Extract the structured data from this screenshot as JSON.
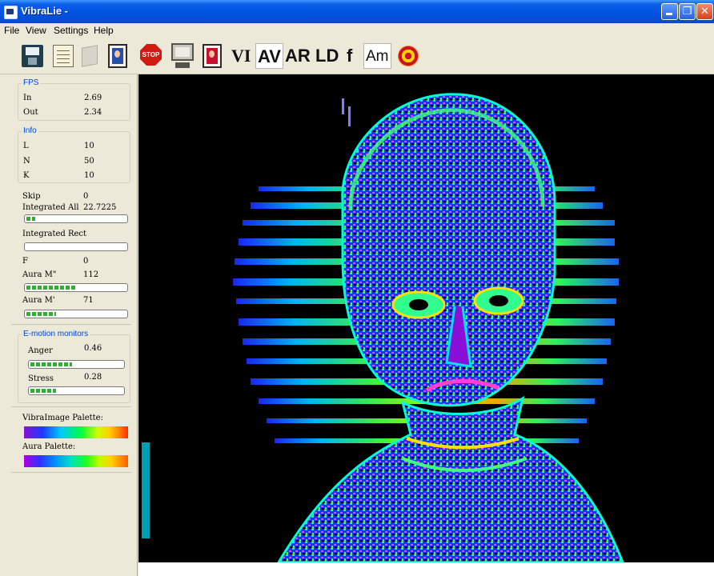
{
  "window": {
    "title": "VibraLie -"
  },
  "menu": [
    "File",
    "View",
    "Settings",
    "Help"
  ],
  "toolbar": {
    "text_buttons": [
      "VI",
      "AV",
      "AR",
      "LD",
      "f",
      "Am"
    ],
    "stop_label": "STOP",
    "icons": [
      "save-icon",
      "document-icon",
      "pages-icon",
      "portrait-blue-icon",
      "stop-icon",
      "monitor-icon",
      "portrait-red-icon",
      "target-icon"
    ]
  },
  "fps": {
    "legend": "FPS",
    "in_label": "In",
    "in_value": "2.69",
    "out_label": "Out",
    "out_value": "2.34"
  },
  "info": {
    "legend": "Info",
    "l_label": "L",
    "l_value": "10",
    "n_label": "N",
    "n_value": "50",
    "k_label": "K",
    "k_value": "10"
  },
  "stats": {
    "skip_label": "Skip",
    "skip_value": "0",
    "integrated_all_label": "Integrated All",
    "integrated_all_value": "22.7225",
    "integrated_all_bar": 0.09,
    "integrated_rect_label": "Integrated Rect",
    "integrated_rect_bar": 0,
    "f_label": "F",
    "f_value": "0",
    "aura_m2_label": "Aura M\"",
    "aura_m2_value": "112",
    "aura_m2_bar": 0.5,
    "aura_m1_label": "Aura M'",
    "aura_m1_value": "71",
    "aura_m1_bar": 0.3
  },
  "emotion": {
    "legend": "E-motion monitors",
    "anger_label": "Anger",
    "anger_value": "0.46",
    "anger_bar": 0.46,
    "stress_label": "Stress",
    "stress_value": "0.28",
    "stress_bar": 0.28
  },
  "palettes": {
    "vibra_label": "VibraImage Palette:",
    "aura_label": "Aura Palette:"
  },
  "colors": {
    "titlebar": "#0054e3",
    "legend": "#0046d5",
    "bar_fill": "#30b030",
    "stop": "#d01a12",
    "viewport_bg": "#000000"
  }
}
